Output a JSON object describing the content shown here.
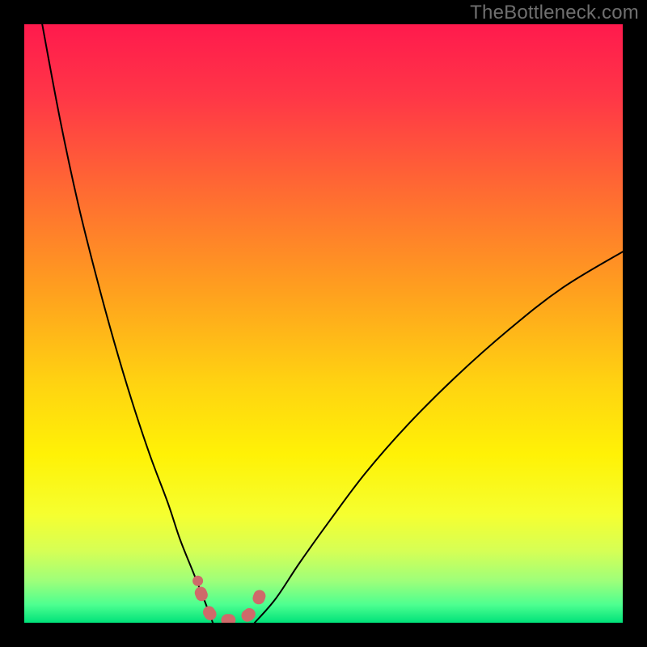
{
  "watermark": "TheBottleneck.com",
  "chart_data": {
    "type": "line",
    "title": "",
    "xlabel": "",
    "ylabel": "",
    "xlim": [
      0,
      100
    ],
    "ylim": [
      0,
      100
    ],
    "series": [
      {
        "name": "left-curve",
        "x": [
          3,
          6,
          9,
          12,
          15,
          18,
          21,
          24,
          26,
          28,
          30,
          31.5
        ],
        "y": [
          100,
          84,
          70,
          58,
          47,
          37,
          28,
          20,
          14,
          9,
          4,
          0
        ]
      },
      {
        "name": "valley-floor",
        "x": [
          31.5,
          38.5
        ],
        "y": [
          0,
          0
        ]
      },
      {
        "name": "right-curve",
        "x": [
          38.5,
          42,
          46,
          51,
          57,
          64,
          72,
          81,
          90,
          100
        ],
        "y": [
          0,
          4,
          10,
          17,
          25,
          33,
          41,
          49,
          56,
          62
        ]
      },
      {
        "name": "valley-marker",
        "x": [
          29.5,
          30.5,
          31.5,
          33,
          35,
          37,
          38.5,
          39.5
        ],
        "y": [
          5,
          2.5,
          1,
          0.5,
          0.5,
          1,
          2.5,
          5
        ]
      },
      {
        "name": "valley-marker-dot",
        "x": [
          29
        ],
        "y": [
          7
        ]
      }
    ],
    "gradient_bands": [
      {
        "stop": 0.0,
        "color": "#ff1a4d"
      },
      {
        "stop": 0.12,
        "color": "#ff3647"
      },
      {
        "stop": 0.28,
        "color": "#ff6b32"
      },
      {
        "stop": 0.44,
        "color": "#ff9e1f"
      },
      {
        "stop": 0.6,
        "color": "#ffd311"
      },
      {
        "stop": 0.72,
        "color": "#fff206"
      },
      {
        "stop": 0.82,
        "color": "#f5ff30"
      },
      {
        "stop": 0.88,
        "color": "#d6ff55"
      },
      {
        "stop": 0.93,
        "color": "#9eff7a"
      },
      {
        "stop": 0.97,
        "color": "#4dff90"
      },
      {
        "stop": 1.0,
        "color": "#00e27a"
      }
    ],
    "curve_color": "#000000",
    "marker_color": "#cf6a6a"
  }
}
